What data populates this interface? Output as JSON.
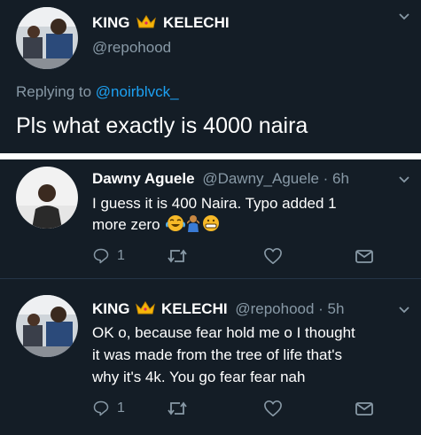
{
  "main_tweet": {
    "display_name": "KING",
    "display_name_suffix": "KELECHI",
    "handle": "@repohood",
    "replying_to_prefix": "Replying to",
    "replying_to_handle": "@noirblvck_",
    "text": "Pls what exactly is 4000 naira"
  },
  "replies": [
    {
      "display_name": "Dawny Aguele",
      "handle": "@Dawny_Aguele",
      "time": "· 6h",
      "text_line1": "I guess it is 400 Naira. Typo added 1",
      "text_line2": "more zero",
      "reply_count": "1",
      "emojis": [
        "crying-laughing-emoji",
        "person-shrugging-emoji",
        "grinning-emoji"
      ]
    },
    {
      "display_name": "KING",
      "display_name_suffix": "KELECHI",
      "handle": "@repohood",
      "time": "· 5h",
      "text_line1": "OK o,  because fear hold me o I thought",
      "text_line2": "it was made from the tree of life that's",
      "text_line3": "why it's 4k. You go fear fear nah",
      "reply_count": "1"
    }
  ],
  "icons": {
    "crown": "crown-emoji",
    "reply": "reply-icon",
    "retweet": "retweet-icon",
    "like": "heart-icon",
    "dm": "envelope-icon",
    "caret": "chevron-down-icon"
  },
  "colors": {
    "background": "#141d26",
    "text": "#ffffff",
    "secondary": "#8899a6",
    "link": "#1da1f2",
    "gap": "#ffffff"
  }
}
